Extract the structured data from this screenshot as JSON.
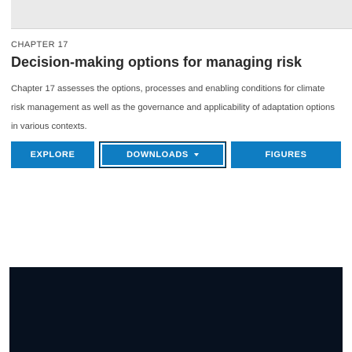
{
  "header": {
    "chapter_label": "CHAPTER 17",
    "title": "Decision-making options for managing risk"
  },
  "main": {
    "description": "Chapter 17 assesses the options, processes and enabling conditions for climate risk management as well as the governance and applicability of adaptation options in various contexts."
  },
  "actions": {
    "explore_label": "EXPLORE",
    "downloads_label": "DOWNLOADS",
    "figures_label": "FIGURES"
  },
  "icons": {
    "downloads_caret": "chevron-down-icon"
  },
  "colors": {
    "button_blue": "#0f7dc2",
    "footer_dark": "#07111f",
    "top_band_gray": "#eaeaea"
  }
}
